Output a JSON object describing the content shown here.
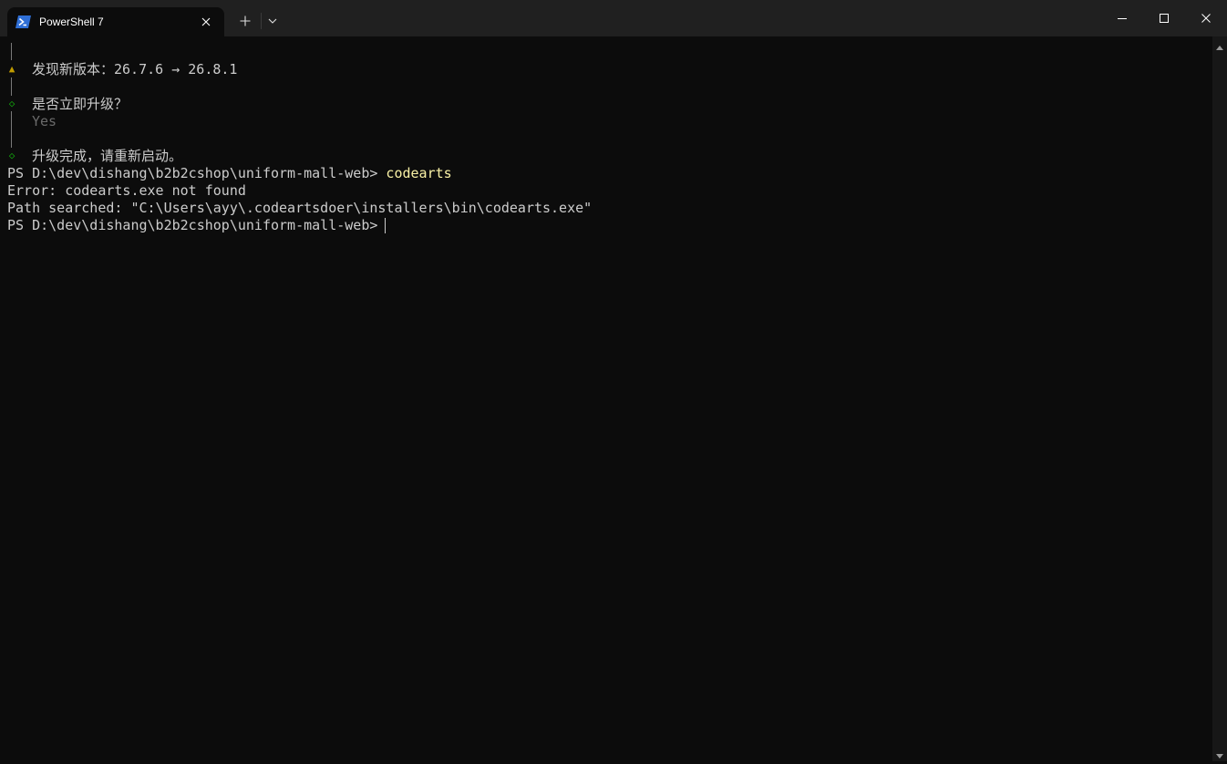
{
  "window": {
    "tab_title": "PowerShell 7",
    "new_tab_symbol": "+",
    "icons": [
      "powershell-icon",
      "close-icon",
      "plus-icon",
      "chevron-down-icon",
      "minimize-icon",
      "maximize-icon",
      "window-close-icon"
    ]
  },
  "terminal": {
    "update_notice": "发现新版本：26.7.6 → 26.8.1",
    "prompt_question": "是否立即升级？",
    "prompt_answer": "Yes",
    "upgrade_done": "升级完成，请重新启动。",
    "prompt_path": "PS D:\\dev\\dishang\\b2b2cshop\\uniform-mall-web>",
    "command": "codearts",
    "error_line": "Error: codearts.exe not found",
    "path_line": "Path searched: \"C:\\Users\\ayy\\.codeartsdoer\\installers\\bin\\codearts.exe\"",
    "prompt_path_2": "PS D:\\dev\\dishang\\b2b2cshop\\uniform-mall-web>",
    "markers": {
      "warn": "▲",
      "ok": "◇"
    },
    "colors": {
      "background": "#0c0c0c",
      "text": "#cccccc",
      "warn": "#c19c00",
      "ok": "#13a10e",
      "command": "#f9f1a5",
      "dim": "#6a6a6a"
    }
  }
}
